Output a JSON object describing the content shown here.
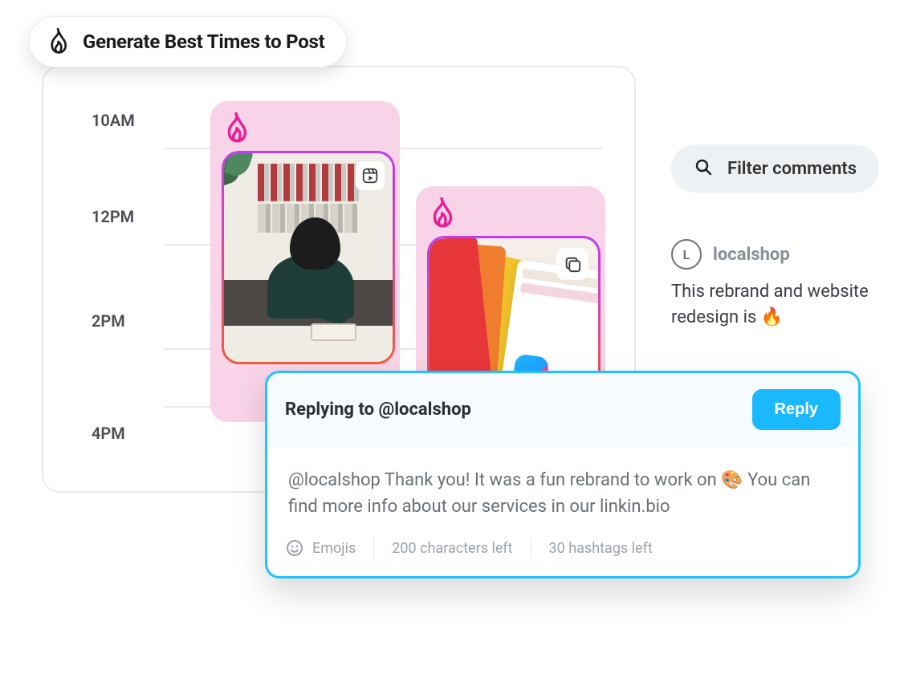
{
  "pill": {
    "label": "Generate Best Times to Post"
  },
  "timeline": {
    "labels": [
      "10AM",
      "12PM",
      "2PM",
      "4PM"
    ]
  },
  "slots": {
    "first": {
      "icon": "flame",
      "media_type": "reel"
    },
    "second": {
      "icon": "flame",
      "media_type": "carousel"
    }
  },
  "filter": {
    "label": "Filter comments"
  },
  "comment": {
    "avatar_initial": "L",
    "username": "localshop",
    "text": "This rebrand and website redesign is 🔥"
  },
  "composer": {
    "replying_to": "Replying to @localshop",
    "reply_button": "Reply",
    "body": "@localshop Thank you! It was a fun rebrand to work on 🎨 You can find more info about our services in our linkin.bio",
    "emojis_label": "Emojis",
    "chars_left": "200 characters left",
    "hashtags_left": "30 hashtags left"
  },
  "colors": {
    "cyan": "#1ab9ff",
    "magenta": "#e91e94",
    "pink_bg": "#f9d3e8"
  }
}
